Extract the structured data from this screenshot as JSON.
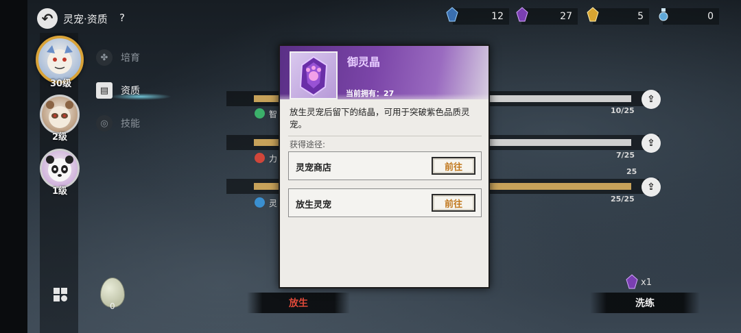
{
  "header": {
    "back_icon": "back-arrow-icon",
    "title": "灵宠·资质",
    "help": "?"
  },
  "currencies": [
    {
      "icon": "blue-crystal-icon",
      "color": "#3a6fb0",
      "value": "12"
    },
    {
      "icon": "purple-crystal-icon",
      "color": "#7a3fb2",
      "value": "27"
    },
    {
      "icon": "gold-crystal-icon",
      "color": "#d8a531",
      "value": "5"
    },
    {
      "icon": "potion-icon",
      "color": "#5fa8d8",
      "value": "0"
    }
  ],
  "pets": [
    {
      "level": "30级"
    },
    {
      "level": "2级"
    },
    {
      "level": "1级"
    }
  ],
  "menu": [
    {
      "label": "培育",
      "icon": "paw-icon"
    },
    {
      "label": "资质",
      "icon": "scroll-icon"
    },
    {
      "label": "技能",
      "icon": "swirl-icon"
    }
  ],
  "stats": [
    {
      "label": "智",
      "value_text": "10/25",
      "value": 10,
      "max": 25,
      "color": "#3bb06a"
    },
    {
      "label": "力",
      "value_text": "7/25",
      "value": 7,
      "max": 25,
      "color": "#d0463a"
    },
    {
      "label": "灵",
      "value_text": "25/25",
      "value": 25,
      "max": 25,
      "marker": "25",
      "color": "#3a8fd0"
    }
  ],
  "bottom": {
    "egg_count": "0",
    "release_label": "放生",
    "refine_label": "洗练",
    "refine_cost": "x1"
  },
  "popup": {
    "item_name": "御灵晶",
    "owned_text": "当前拥有：27",
    "description": "放生灵宠后留下的结晶，可用于突破紫色品质灵宠。",
    "source_title": "获得途径:",
    "sources": [
      {
        "name": "灵宠商店",
        "button": "前往"
      },
      {
        "name": "放生灵宠",
        "button": "前往"
      }
    ]
  }
}
